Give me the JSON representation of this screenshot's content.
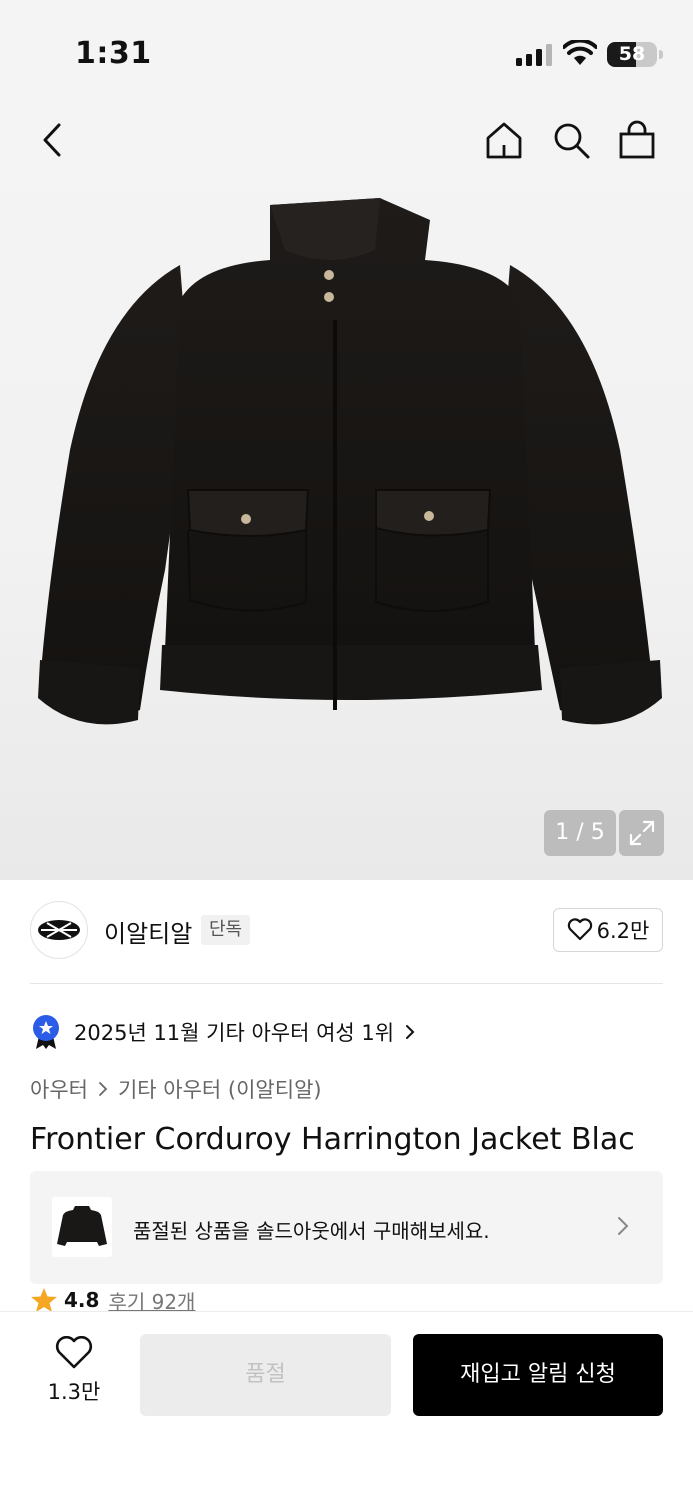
{
  "status": {
    "time": "1:31",
    "battery": "58"
  },
  "nav": {
    "icons": [
      "chevron-left-icon",
      "home-icon",
      "search-icon",
      "bag-icon"
    ]
  },
  "gallery": {
    "counter": "1 / 5"
  },
  "brand": {
    "name": "이알티알",
    "badge": "단독",
    "likes": "6.2만"
  },
  "ranking": {
    "text": "2025년 11월 기타 아우터 여성 1위"
  },
  "breadcrumb": {
    "level1": "아우터",
    "level2": "기타 아우터 (이알티알)"
  },
  "product": {
    "title": "Frontier Corduroy Harrington Jacket Blac"
  },
  "soldout_banner": {
    "text": "품절된 상품을 솔드아웃에서 구매해보세요."
  },
  "rating": {
    "score": "4.8",
    "reviews": "후기 92개"
  },
  "bottom_bar": {
    "wish_count": "1.3만",
    "soldout_label": "품절",
    "restock_label": "재입고 알림 신청"
  },
  "colors": {
    "accent": "#000000",
    "rank_badge": "#2a5ce8",
    "star": "#f5a623"
  }
}
